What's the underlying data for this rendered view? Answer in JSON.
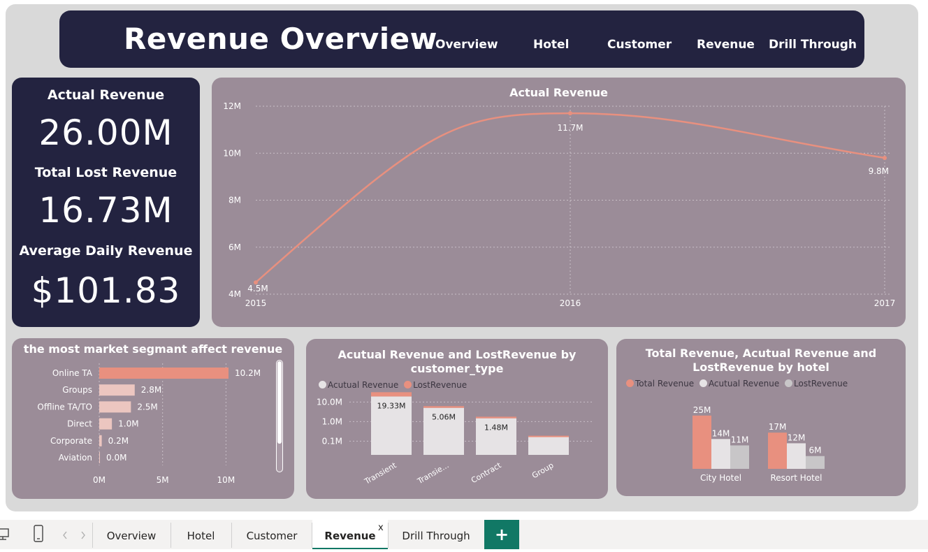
{
  "header": {
    "title": "Revenue Overview",
    "nav": [
      "Overview",
      "Hotel",
      "Customer",
      "Revenue",
      "Drill Through"
    ]
  },
  "kpis": [
    {
      "label": "Actual Revenue",
      "value": "26.00M"
    },
    {
      "label": "Total Lost Revenue",
      "value": "16.73M"
    },
    {
      "label": "Average Daily Revenue",
      "value": "$101.83"
    }
  ],
  "colors": {
    "dark": "#232340",
    "panel": "#9b8c98",
    "salmon": "#e8907f",
    "light": "#e6e3e5",
    "grey": "#c8c6c8",
    "canvas": "#d9d9d9",
    "tab_active": "#117865"
  },
  "chart_data": [
    {
      "type": "line",
      "title": "Actual Revenue",
      "x": [
        "2015",
        "2016",
        "2017"
      ],
      "series": [
        {
          "values": [
            4.5,
            11.7,
            9.8
          ],
          "labels": [
            "4.5M",
            "11.7M",
            "9.8M"
          ]
        }
      ],
      "y_ticks": [
        "12M",
        "10M",
        "8M",
        "6M",
        "4M"
      ],
      "ylim": [
        4,
        12
      ],
      "grid": true
    },
    {
      "type": "bar",
      "orientation": "horizontal",
      "title": "the most market segmant affect revenue",
      "categories": [
        "Online TA",
        "Groups",
        "Offline TA/TO",
        "Direct",
        "Corporate",
        "Aviation"
      ],
      "values": [
        10.2,
        2.8,
        2.5,
        1.0,
        0.2,
        0.0
      ],
      "labels": [
        "10.2M",
        "2.8M",
        "2.5M",
        "1.0M",
        "0.2M",
        "0.0M"
      ],
      "x_ticks": [
        "0M",
        "5M",
        "10M"
      ],
      "xlim": [
        0,
        10.2
      ]
    },
    {
      "type": "bar",
      "stacked": true,
      "log_scale": true,
      "title": "Acutual Revenue and LostRevenue by customer_type",
      "legend": [
        "Acutual Revenue",
        "LostRevenue"
      ],
      "categories": [
        "Transient",
        "Transie...",
        "Contract",
        "Group"
      ],
      "series": [
        {
          "name": "Acutual Revenue",
          "values": [
            19.33,
            5.06,
            1.48,
            0.17
          ]
        },
        {
          "name": "LostRevenue",
          "values": [
            12.5,
            1.1,
            0.3,
            0.02
          ]
        }
      ],
      "bar_labels": [
        "19.33M",
        "5.06M",
        "1.48M",
        ""
      ],
      "y_ticks": [
        "10.0M",
        "1.0M",
        "0.1M"
      ]
    },
    {
      "type": "bar",
      "title": "Total Revenue, Acutual Revenue and LostRevenue by hotel",
      "legend": [
        "Total Revenue",
        "Acutual Revenue",
        "LostRevenue"
      ],
      "categories": [
        "City Hotel",
        "Resort Hotel"
      ],
      "series": [
        {
          "name": "Total Revenue",
          "values": [
            25,
            17
          ],
          "labels": [
            "25M",
            "17M"
          ]
        },
        {
          "name": "Acutual Revenue",
          "values": [
            14,
            12
          ],
          "labels": [
            "14M",
            "12M"
          ]
        },
        {
          "name": "LostRevenue",
          "values": [
            11,
            6
          ],
          "labels": [
            "11M",
            "6M"
          ]
        }
      ]
    }
  ],
  "tabs": {
    "pages": [
      "Overview",
      "Hotel",
      "Customer",
      "Revenue",
      "Drill Through"
    ],
    "active": "Revenue",
    "close_glyph": "x",
    "add_glyph": "+"
  }
}
